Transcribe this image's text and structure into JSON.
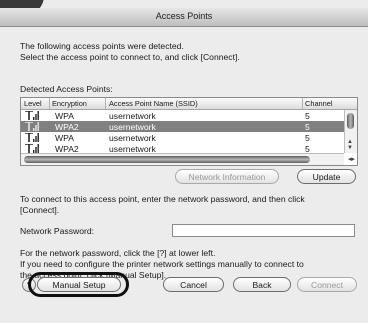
{
  "window": {
    "title": "Access Points"
  },
  "intro": {
    "line1": "The following access points were detected.",
    "line2": "Select the access point to connect to, and click [Connect]."
  },
  "list": {
    "caption": "Detected Access Points:",
    "headers": {
      "level": "Level",
      "encryption": "Encryption",
      "ssid": "Access Point Name (SSID)",
      "channel": "Channel"
    },
    "rows": [
      {
        "encryption": "WPA",
        "ssid": "usernetwork",
        "channel": "5",
        "selected": false
      },
      {
        "encryption": "WPA2",
        "ssid": "usernetwork",
        "channel": "5",
        "selected": true
      },
      {
        "encryption": "WPA",
        "ssid": "usernetwork",
        "channel": "5",
        "selected": false
      },
      {
        "encryption": "WPA2",
        "ssid": "usernetwork",
        "channel": "5",
        "selected": false
      }
    ]
  },
  "buttons": {
    "network_info": "Network Information",
    "update": "Update",
    "manual_setup": "Manual Setup",
    "cancel": "Cancel",
    "back": "Back",
    "connect": "Connect",
    "help": "?"
  },
  "connect_text": {
    "line1": "To connect to this access point, enter the network password, and then click",
    "line2": "[Connect]."
  },
  "password": {
    "label": "Network Password:",
    "value": ""
  },
  "help_text": {
    "line1": "For the network password, click the [?] at lower left.",
    "line2": "If you need to configure the printer network settings manually to connect to",
    "line3": "the access point, click [Manual Setup]."
  },
  "icons": {
    "signal": "signal-strength-icon"
  },
  "colors": {
    "selected_row": "#808080",
    "highlight_ring": "#101010"
  }
}
